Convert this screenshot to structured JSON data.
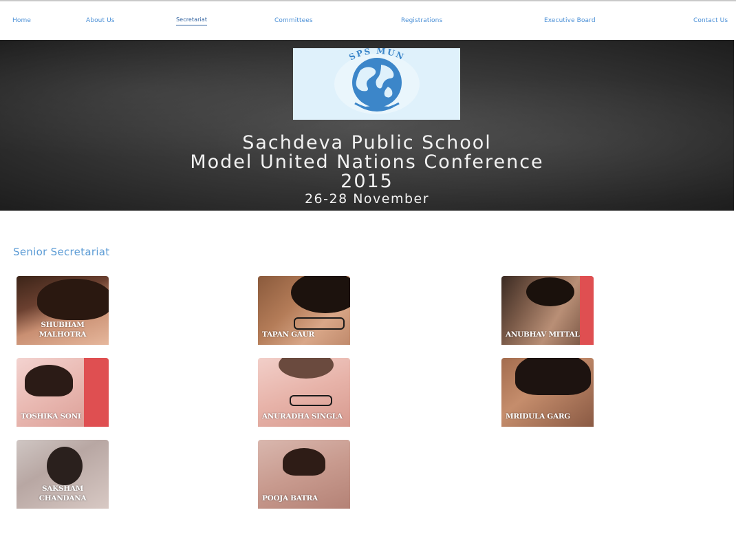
{
  "nav": {
    "items": [
      {
        "label": "Home"
      },
      {
        "label": "About Us"
      },
      {
        "label": "Secretariat",
        "active": true
      },
      {
        "label": "Committees"
      },
      {
        "label": "Registrations"
      },
      {
        "label": "Executive Board"
      },
      {
        "label": "Contact Us"
      }
    ]
  },
  "banner": {
    "logo_text": "SPS MUN",
    "line1": "Sachdeva Public School",
    "line2": "Model United Nations Conference",
    "line3": "2015",
    "dates": "26-28 November"
  },
  "section": {
    "heading": "Senior Secretariat"
  },
  "members": [
    {
      "name": "SHUBHAM MALHOTRA"
    },
    {
      "name": "TAPAN GAUR"
    },
    {
      "name": "ANUBHAV MITTAL"
    },
    {
      "name": "TOSHIKA SONI"
    },
    {
      "name": "ANURADHA SINGLA"
    },
    {
      "name": "MRIDULA GARG"
    },
    {
      "name": "SAKSHAM CHANDANA"
    },
    {
      "name": "POOJA BATRA"
    }
  ],
  "colors": {
    "nav_link": "#4a8fd6",
    "heading": "#5b9bd5",
    "accent_band": "#df4f51",
    "banner_bg": "#3a3a3a"
  }
}
